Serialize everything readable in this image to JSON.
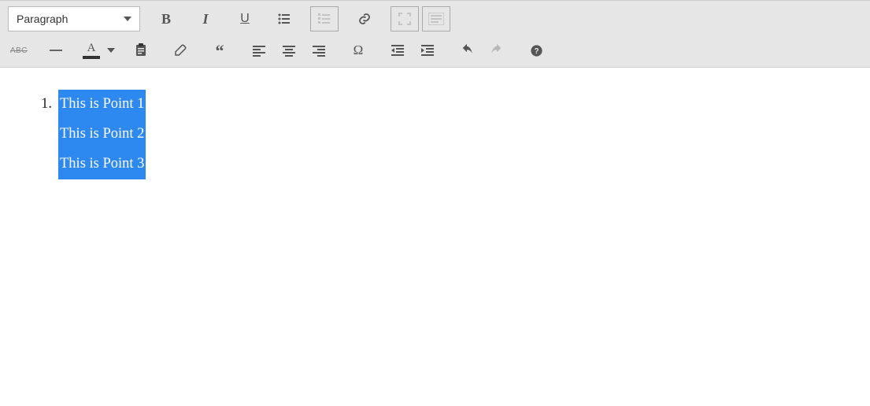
{
  "toolbar": {
    "format_label": "Paragraph",
    "row1": {
      "bold": "B",
      "italic": "I",
      "underline": "U"
    }
  },
  "content": {
    "list_marker": "1.",
    "lines": [
      "This is Point 1",
      "This is Point 2",
      "This is Point 3"
    ]
  }
}
